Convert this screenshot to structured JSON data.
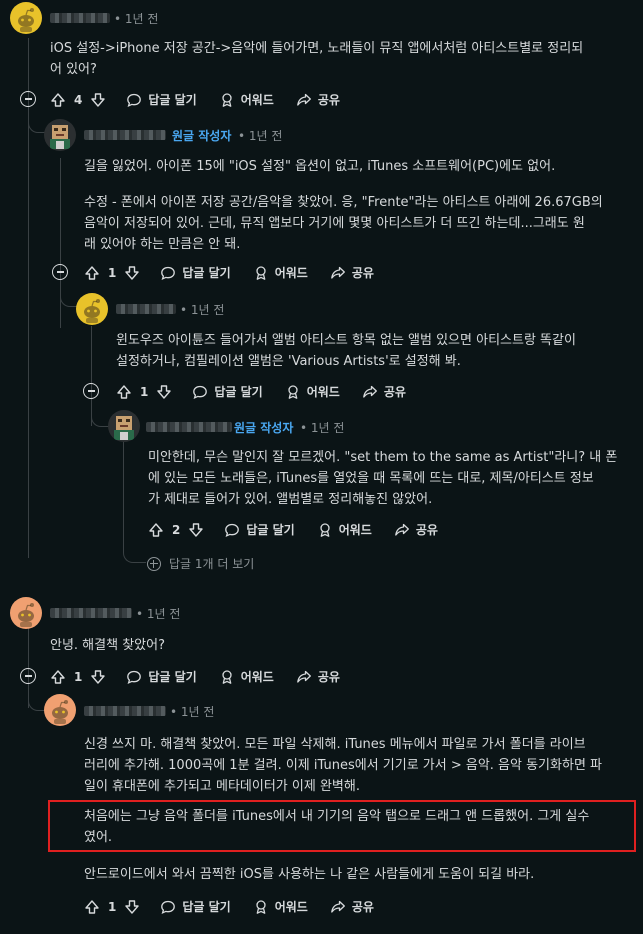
{
  "comments": [
    {
      "time": "1년 전",
      "body": [
        "iOS 설정->iPhone 저장 공간->음악에 들어가면, 노래들이 뮤직 앱에서처럼 아티스트별로 정리되",
        "어 있어?"
      ],
      "votes": "4"
    },
    {
      "op_badge": "원글 작성자",
      "time": "1년 전",
      "body1": [
        "길을 잃었어. 아이폰 15에 \"iOS 설정\" 옵션이 없고, iTunes 소프트웨어(PC)에도 없어."
      ],
      "body2": [
        "수정 - 폰에서 아이폰 저장 공간/음악을 찾았어. 응, \"Frente\"라는 아티스트 아래에 26.67GB의",
        "음악이 저장되어 있어. 근데, 뮤직 앱보다 거기에 몇몇 아티스트가 더 뜨긴 하는데...그래도 원",
        "래 있어야 하는 만큼은 안 돼."
      ],
      "votes": "1"
    },
    {
      "time": "1년 전",
      "body": [
        "윈도우즈 아이튠즈 들어가서 앨범 아티스트 항목 없는 앨범 있으면 아티스트랑 똑같이",
        "설정하거나, 컴필레이션 앨범은 'Various Artists'로 설정해 봐."
      ],
      "votes": "1"
    },
    {
      "op_badge": "원글 작성자",
      "time": "1년 전",
      "body": [
        "미안한데, 무슨 말인지 잘 모르겠어. \"set them to the same as Artist\"라니? 내 폰",
        "에 있는 모든 노래들은, iTunes를 열었을 때 목록에 뜨는 대로, 제목/아티스트 정보",
        "가 제대로 들어가 있어. 앨범별로 정리해놓진 않았어."
      ],
      "votes": "2"
    },
    {
      "time": "1년 전",
      "body": [
        "안녕. 해결책 찾았어?"
      ],
      "votes": "1"
    },
    {
      "time": "1년 전",
      "body1": [
        "신경 쓰지 마. 해결책 찾았어. 모든 파일 삭제해. iTunes 메뉴에서 파일로 가서 폴더를 라이브",
        "러리에 추가해. 1000곡에 1분 걸려. 이제 iTunes에서 기기로 가서 > 음악. 음악 동기화하면 파",
        "일이 휴대폰에 추가되고 메타데이터가 이제 완벽해."
      ],
      "body2": [
        "처음에는 그냥 음악 폴더를 iTunes에서 내 기기의 음악 탭으로 드래그 앤 드롭했어. 그게 실수",
        "였어."
      ],
      "body3": [
        "안드로이드에서 와서 끔찍한 iOS를 사용하는 나 같은 사람들에게 도움이 되길 바라."
      ],
      "votes": "1"
    }
  ],
  "actions": {
    "reply": "답글 달기",
    "award": "어워드",
    "share": "공유"
  },
  "more_replies": "답글 1개 더 보기",
  "icons": {
    "upvote": "upvote-icon",
    "downvote": "downvote-icon",
    "reply": "comment-bubble-icon",
    "award": "award-icon",
    "share": "share-icon",
    "collapse": "collapse-icon",
    "expand": "expand-plus-icon"
  },
  "colors": {
    "background": "#0b1416",
    "op_badge": "#4aa7f0",
    "highlight": "#e02020"
  }
}
